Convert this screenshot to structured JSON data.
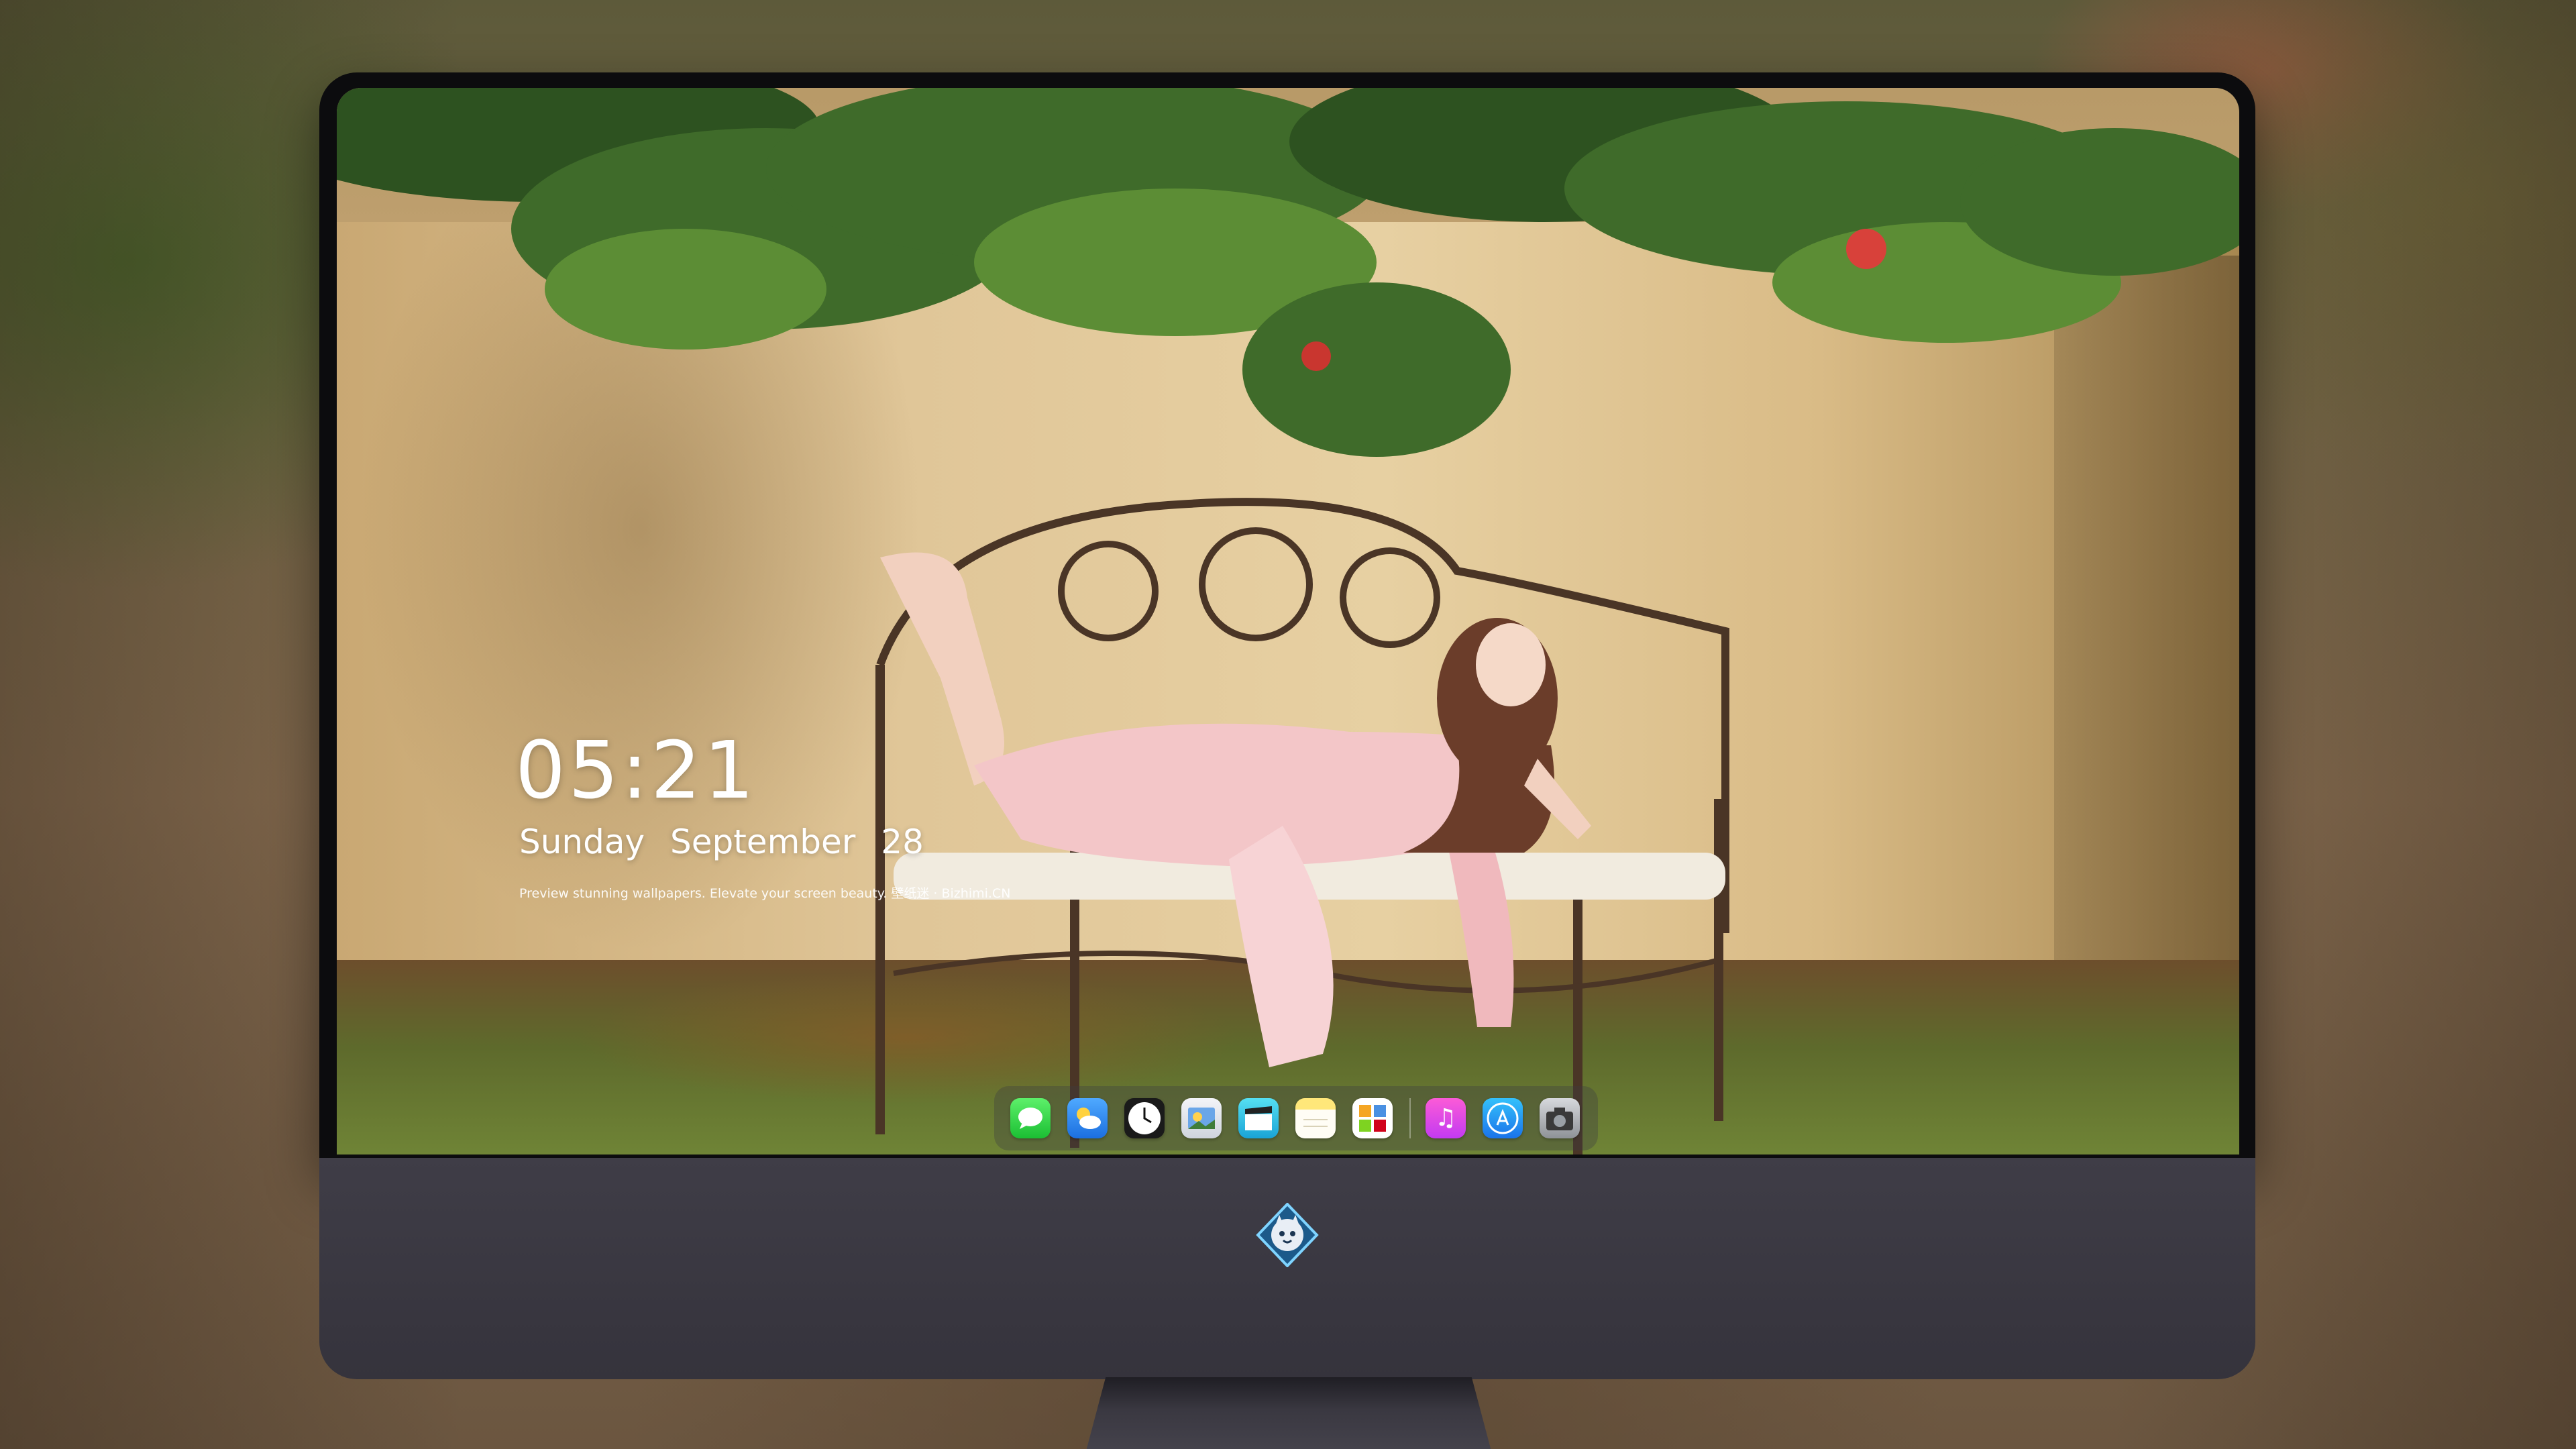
{
  "lockscreen": {
    "time": "05:21",
    "weekday": "Sunday",
    "month": "September",
    "day": "28",
    "tagline": "Preview stunning wallpapers. Elevate your screen beauty. 壁纸迷 · Bizhimi.CN"
  },
  "dock": {
    "apps": [
      {
        "name": "messages",
        "icon": "messages-icon"
      },
      {
        "name": "weather",
        "icon": "weather-icon"
      },
      {
        "name": "clock",
        "icon": "clock-icon"
      },
      {
        "name": "preview",
        "icon": "preview-icon"
      },
      {
        "name": "video",
        "icon": "clapperboard-icon"
      },
      {
        "name": "notes",
        "icon": "notes-icon"
      },
      {
        "name": "photos",
        "icon": "photos-icon"
      },
      {
        "name": "music",
        "icon": "music-icon"
      },
      {
        "name": "app-store",
        "icon": "app-store-icon"
      },
      {
        "name": "camera",
        "icon": "camera-icon"
      }
    ]
  },
  "monitor": {
    "chin_logo": "cat-mascot-logo"
  },
  "colors": {
    "bezel": "#0c0c0e",
    "chin": "#3f3d47",
    "dress": "#f3c6c8",
    "foliage": "#3f6b2a"
  }
}
